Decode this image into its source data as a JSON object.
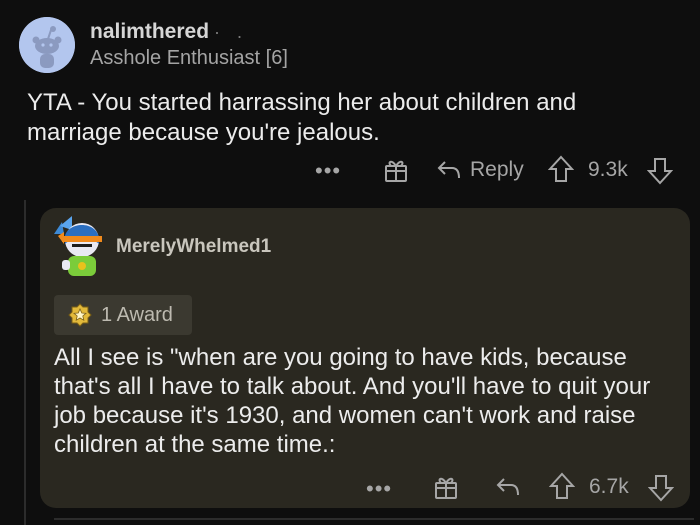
{
  "comment": {
    "username": "nalimthered",
    "separator": "· .",
    "flair": "Asshole Enthusiast [6]",
    "body": "YTA - You started harrassing her about children and marriage because you're jealous.",
    "actions": {
      "more": "•••",
      "reply_label": "Reply",
      "vote_count": "9.3k"
    }
  },
  "reply": {
    "username": "MerelyWhelmed1",
    "award_label": "1 Award",
    "body": "All I see is \"when are you going to have kids, because that's all I have to talk about.  And you'll have to quit your job because it's 1930, and women can't work and raise children at the same time.:",
    "actions": {
      "more": "•••",
      "vote_count": "6.7k"
    }
  },
  "icons": {
    "avatar": "snoo-avatar-icon",
    "gift": "gift-icon",
    "reply": "reply-arrow-icon",
    "upvote": "upvote-arrow-icon",
    "downvote": "downvote-arrow-icon",
    "award": "award-star-icon"
  },
  "colors": {
    "background": "#0e0e0e",
    "card": "#2a2820",
    "text": "#ececec",
    "muted": "#a6a6a6"
  }
}
